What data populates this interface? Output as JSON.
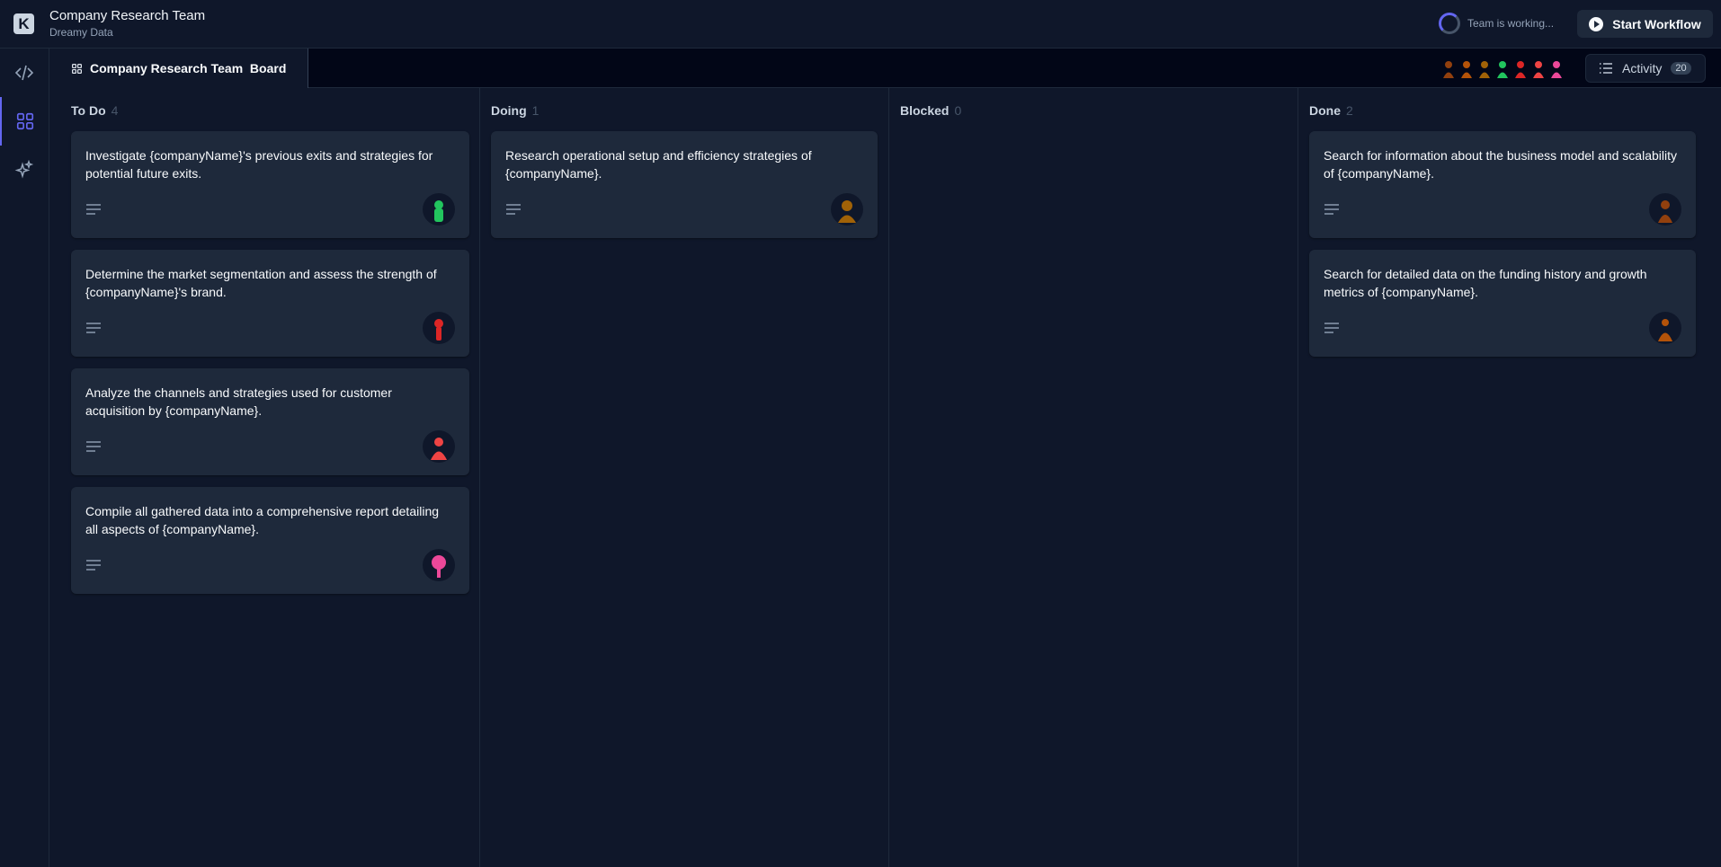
{
  "header": {
    "logo_letter": "K",
    "title": "Company Research Team",
    "subtitle": "Dreamy Data",
    "status": "Team is working...",
    "start_label": "Start Workflow"
  },
  "subbar": {
    "board_tab": "Company Research Team  Board",
    "activity_label": "Activity",
    "activity_count": "20"
  },
  "columns": [
    {
      "name": "To Do",
      "count": "4"
    },
    {
      "name": "Doing",
      "count": "1"
    },
    {
      "name": "Blocked",
      "count": "0"
    },
    {
      "name": "Done",
      "count": "2"
    }
  ],
  "cards": {
    "todo": [
      {
        "title": "Investigate {companyName}'s previous exits and strategies for potential future exits.",
        "avatar_color": "#22c55e"
      },
      {
        "title": "Determine the market segmentation and assess the strength of {companyName}'s brand.",
        "avatar_color": "#dc2626"
      },
      {
        "title": "Analyze the channels and strategies used for customer acquisition by {companyName}.",
        "avatar_color": "#ef4444"
      },
      {
        "title": "Compile all gathered data into a comprehensive report detailing all aspects of {companyName}.",
        "avatar_color": "#ec4899"
      }
    ],
    "doing": [
      {
        "title": "Research operational setup and efficiency strategies of {companyName}.",
        "avatar_color": "#a16207"
      }
    ],
    "done": [
      {
        "title": "Search for information about the business model and scalability of {companyName}.",
        "avatar_color": "#92400e"
      },
      {
        "title": "Search for detailed data on the funding history and growth metrics of {companyName}.",
        "avatar_color": "#b45309"
      }
    ]
  },
  "team_avatar_colors": [
    "#92400e",
    "#b45309",
    "#a16207",
    "#22c55e",
    "#dc2626",
    "#ef4444",
    "#ec4899"
  ],
  "colors": {
    "accent": "#6366f1"
  }
}
